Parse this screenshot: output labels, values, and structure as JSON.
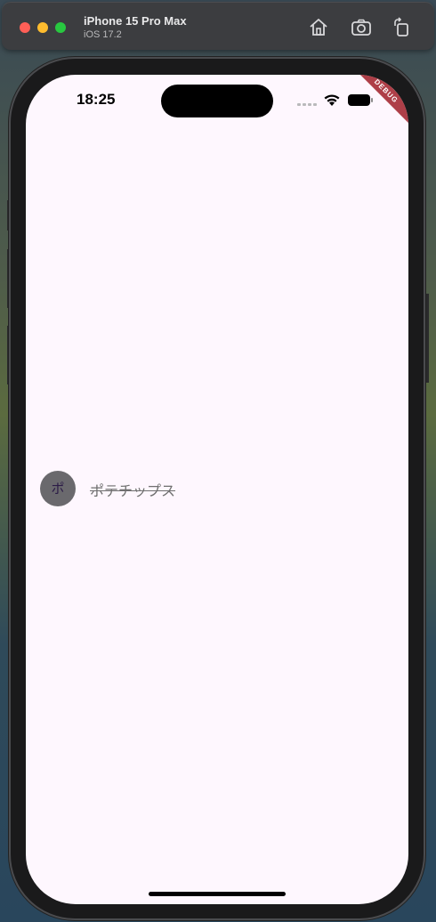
{
  "window": {
    "device_name": "iPhone 15 Pro Max",
    "os_version": "iOS 17.2",
    "toolbar_icons": [
      "home-icon",
      "screenshot-icon",
      "rotate-icon"
    ]
  },
  "status_bar": {
    "time": "18:25"
  },
  "debug_banner": {
    "label": "DEBUG"
  },
  "list": {
    "items": [
      {
        "avatar_text": "ポ",
        "title": "ポテチップス",
        "completed": true
      }
    ]
  },
  "colors": {
    "screen_background": "#fef7fe",
    "avatar_background": "#6a696d",
    "debug_banner": "#a01e28"
  }
}
